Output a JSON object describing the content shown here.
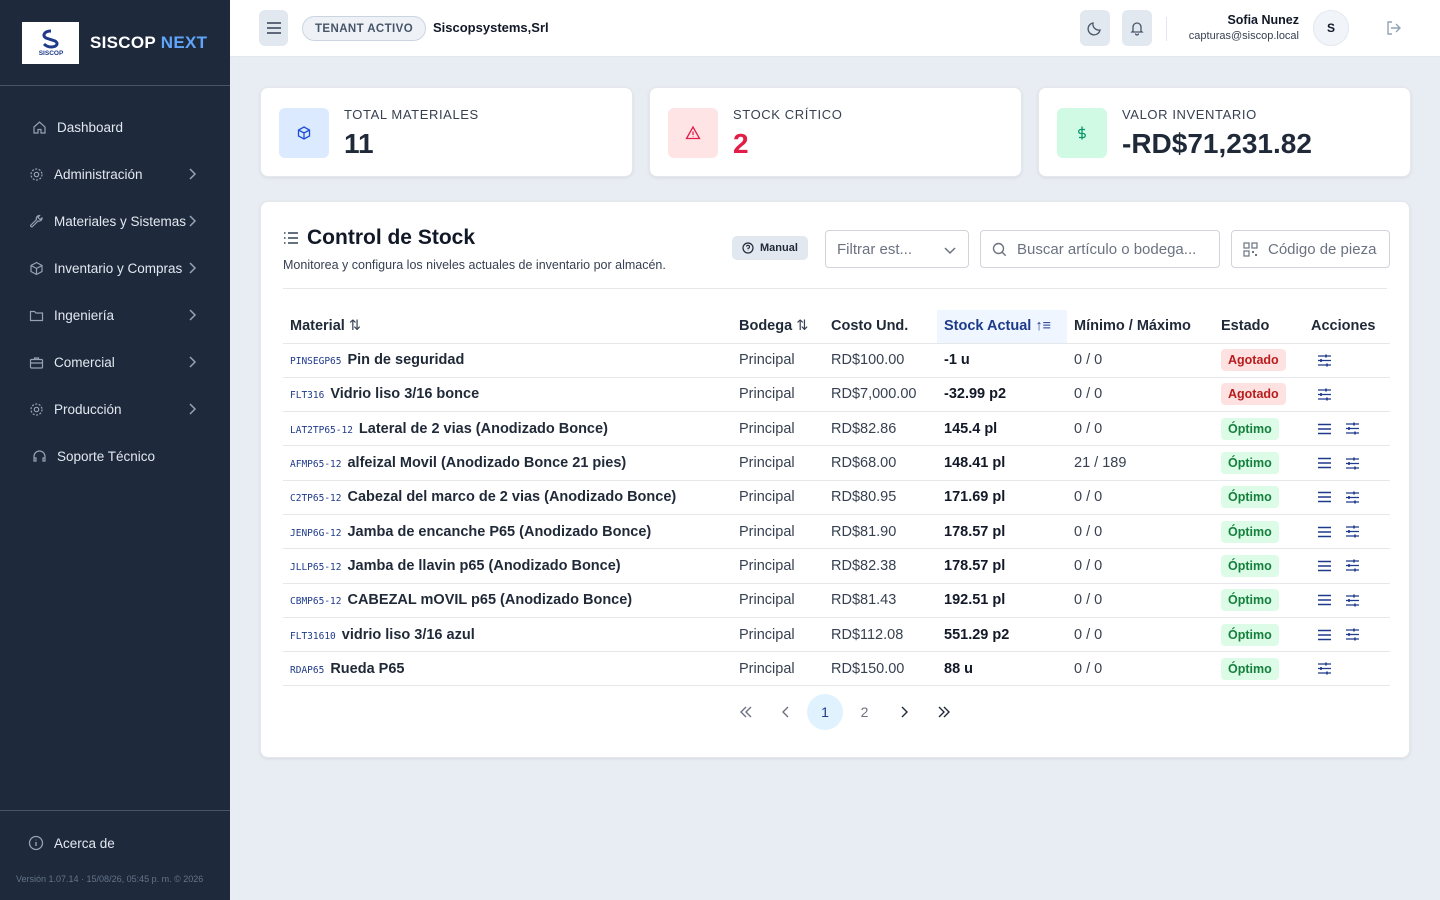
{
  "brand": {
    "name": "SISCOP",
    "suffix": "NEXT",
    "logo_text": "SISCOP"
  },
  "sidebar": {
    "items": [
      {
        "label": "Dashboard",
        "icon": "home-icon",
        "has_sub": false
      },
      {
        "label": "Administración",
        "icon": "gear-icon",
        "has_sub": true
      },
      {
        "label": "Materiales y Sistemas",
        "icon": "wrench-icon",
        "has_sub": true
      },
      {
        "label": "Inventario y Compras",
        "icon": "box-icon",
        "has_sub": true
      },
      {
        "label": "Ingeniería",
        "icon": "folder-icon",
        "has_sub": true
      },
      {
        "label": "Comercial",
        "icon": "briefcase-icon",
        "has_sub": true
      },
      {
        "label": "Producción",
        "icon": "gear-icon",
        "has_sub": true
      },
      {
        "label": "Soporte Técnico",
        "icon": "headset-icon",
        "has_sub": false
      }
    ],
    "about": "Acerca de",
    "version": "Versión 1.07.14 · 15/08/26, 05:45 p. m. © 2026"
  },
  "header": {
    "tenant_label": "TENANT ACTIVO",
    "tenant_name": "Siscopsystems,Srl",
    "user_name": "Sofia Nunez",
    "user_email": "capturas@siscop.local",
    "avatar_initial": "S"
  },
  "stats": [
    {
      "label": "TOTAL MATERIALES",
      "value": "11",
      "icon": "cube-icon",
      "bg": "#dbeafe",
      "fg": "#1d4ed8",
      "value_color": "#1f2937"
    },
    {
      "label": "STOCK CRÍTICO",
      "value": "2",
      "icon": "warning-icon",
      "bg": "#ffe4e6",
      "fg": "#e11d48",
      "value_color": "#e11d48"
    },
    {
      "label": "VALOR INVENTARIO",
      "value": "-RD$71,231.82",
      "icon": "dollar-icon",
      "bg": "#d1fae5",
      "fg": "#059669",
      "value_color": "#1f2937"
    }
  ],
  "panel": {
    "title": "Control de Stock",
    "subtitle": "Monitorea y configura los niveles actuales de inventario por almacén.",
    "manual_label": "Manual",
    "filter_placeholder": "Filtrar est...",
    "search_placeholder": "Buscar artículo o bodega...",
    "code_placeholder": "Código de pieza"
  },
  "table": {
    "columns": [
      "Material",
      "Bodega",
      "Costo Und.",
      "Stock Actual",
      "Mínimo / Máximo",
      "Estado",
      "Acciones"
    ],
    "rows": [
      {
        "code": "PINSEGP65",
        "name": "Pin de seguridad",
        "bodega": "Principal",
        "costo": "RD$100.00",
        "stock": "-1 u",
        "minmax": "0 / 0",
        "estado": "Agotado",
        "ok": false,
        "acts": [
          "adjust"
        ]
      },
      {
        "code": "FLT316",
        "name": "Vidrio liso 3/16 bonce",
        "bodega": "Principal",
        "costo": "RD$7,000.00",
        "stock": "-32.99 p2",
        "minmax": "0 / 0",
        "estado": "Agotado",
        "ok": false,
        "acts": [
          "adjust"
        ]
      },
      {
        "code": "LAT2TP65-12",
        "name": "Lateral de 2 vias (Anodizado Bonce)",
        "bodega": "Principal",
        "costo": "RD$82.86",
        "stock": "145.4 pl",
        "minmax": "0 / 0",
        "estado": "Óptimo",
        "ok": true,
        "acts": [
          "list",
          "adjust"
        ]
      },
      {
        "code": "AFMP65-12",
        "name": "alfeizal Movil (Anodizado Bonce 21 pies)",
        "bodega": "Principal",
        "costo": "RD$68.00",
        "stock": "148.41 pl",
        "minmax": "21 / 189",
        "estado": "Óptimo",
        "ok": true,
        "acts": [
          "list",
          "adjust"
        ]
      },
      {
        "code": "C2TP65-12",
        "name": "Cabezal del marco de 2 vias (Anodizado Bonce)",
        "bodega": "Principal",
        "costo": "RD$80.95",
        "stock": "171.69 pl",
        "minmax": "0 / 0",
        "estado": "Óptimo",
        "ok": true,
        "acts": [
          "list",
          "adjust"
        ]
      },
      {
        "code": "JENP6G-12",
        "name": "Jamba de encanche P65 (Anodizado Bonce)",
        "bodega": "Principal",
        "costo": "RD$81.90",
        "stock": "178.57 pl",
        "minmax": "0 / 0",
        "estado": "Óptimo",
        "ok": true,
        "acts": [
          "list",
          "adjust"
        ]
      },
      {
        "code": "JLLP65-12",
        "name": "Jamba de llavin p65 (Anodizado Bonce)",
        "bodega": "Principal",
        "costo": "RD$82.38",
        "stock": "178.57 pl",
        "minmax": "0 / 0",
        "estado": "Óptimo",
        "ok": true,
        "acts": [
          "list",
          "adjust"
        ]
      },
      {
        "code": "CBMP65-12",
        "name": "CABEZAL mOVIL p65 (Anodizado Bonce)",
        "bodega": "Principal",
        "costo": "RD$81.43",
        "stock": "192.51 pl",
        "minmax": "0 / 0",
        "estado": "Óptimo",
        "ok": true,
        "acts": [
          "list",
          "adjust"
        ]
      },
      {
        "code": "FLT31610",
        "name": "vidrio liso 3/16 azul",
        "bodega": "Principal",
        "costo": "RD$112.08",
        "stock": "551.29 p2",
        "minmax": "0 / 0",
        "estado": "Óptimo",
        "ok": true,
        "acts": [
          "list",
          "adjust"
        ]
      },
      {
        "code": "RDAP65",
        "name": "Rueda P65",
        "bodega": "Principal",
        "costo": "RD$150.00",
        "stock": "88 u",
        "minmax": "0 / 0",
        "estado": "Óptimo",
        "ok": true,
        "acts": [
          "adjust"
        ]
      }
    ]
  },
  "pagination": {
    "pages": [
      "1",
      "2"
    ],
    "current": "1"
  }
}
